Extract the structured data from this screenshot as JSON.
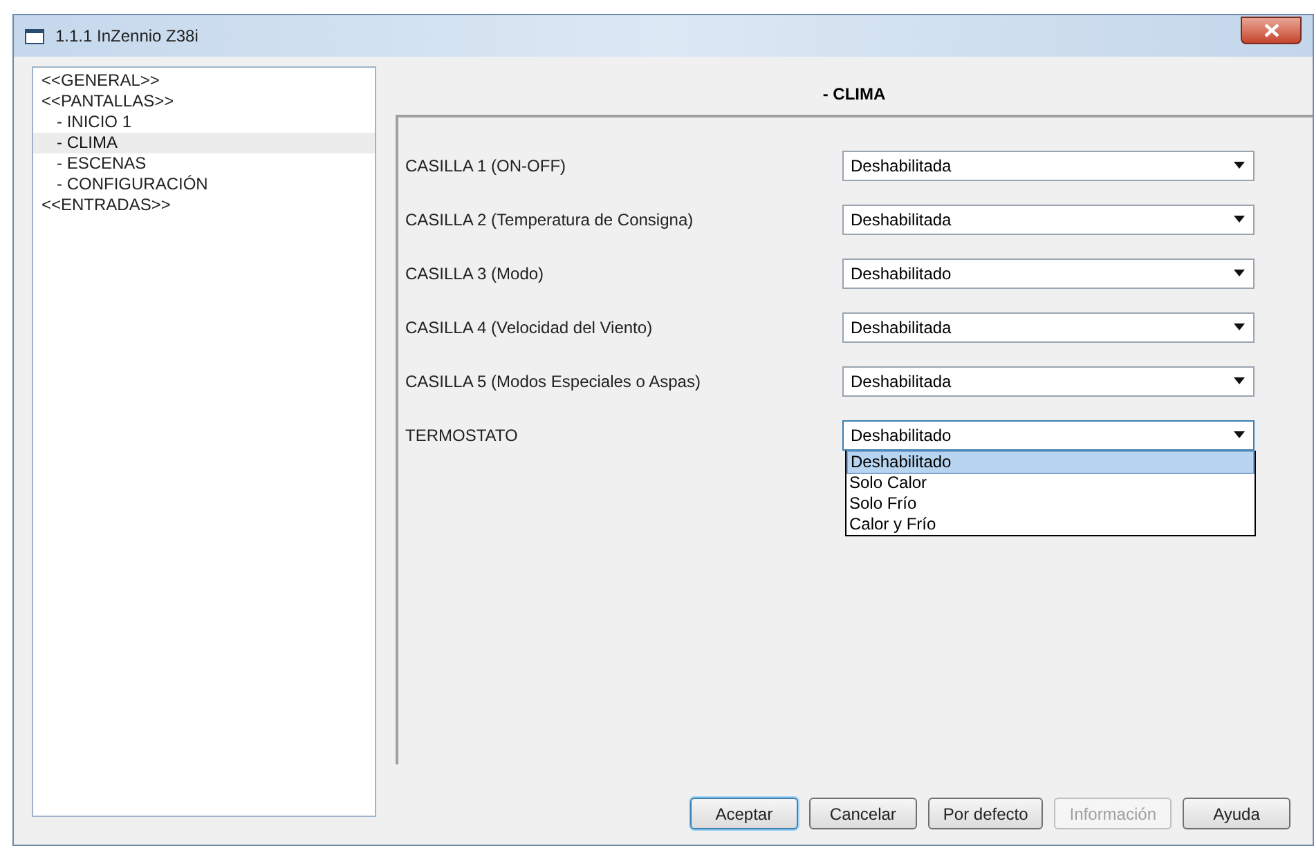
{
  "window": {
    "title": "1.1.1 InZennio Z38i"
  },
  "tree": [
    {
      "label": "<<GENERAL>>",
      "selected": false
    },
    {
      "label": "<<PANTALLAS>>",
      "selected": false,
      "children": [
        {
          "label": "- INICIO 1",
          "selected": false
        },
        {
          "label": "- CLIMA",
          "selected": true
        },
        {
          "label": "- ESCENAS",
          "selected": false
        },
        {
          "label": "- CONFIGURACIÓN",
          "selected": false
        }
      ]
    },
    {
      "label": "<<ENTRADAS>>",
      "selected": false
    }
  ],
  "panel": {
    "title": "- CLIMA"
  },
  "settings": [
    {
      "label": "CASILLA 1 (ON-OFF)",
      "value": "Deshabilitada",
      "expanded": false
    },
    {
      "label": "CASILLA 2 (Temperatura de Consigna)",
      "value": "Deshabilitada",
      "expanded": false
    },
    {
      "label": "CASILLA 3 (Modo)",
      "value": "Deshabilitado",
      "expanded": false
    },
    {
      "label": "CASILLA 4 (Velocidad del Viento)",
      "value": "Deshabilitada",
      "expanded": false
    },
    {
      "label": "CASILLA 5 (Modos Especiales o Aspas)",
      "value": "Deshabilitada",
      "expanded": false
    },
    {
      "label": "TERMOSTATO",
      "value": "Deshabilitado",
      "expanded": true,
      "options": [
        {
          "label": "Deshabilitado",
          "selected": true
        },
        {
          "label": "Solo Calor",
          "selected": false
        },
        {
          "label": "Solo Frío",
          "selected": false
        },
        {
          "label": "Calor y Frío",
          "selected": false
        }
      ]
    }
  ],
  "buttons": [
    {
      "label": "Aceptar",
      "disabled": false,
      "default": true
    },
    {
      "label": "Cancelar",
      "disabled": false,
      "default": false
    },
    {
      "label": "Por defecto",
      "disabled": false,
      "default": false
    },
    {
      "label": "Información",
      "disabled": true,
      "default": false
    },
    {
      "label": "Ayuda",
      "disabled": false,
      "default": false
    }
  ]
}
